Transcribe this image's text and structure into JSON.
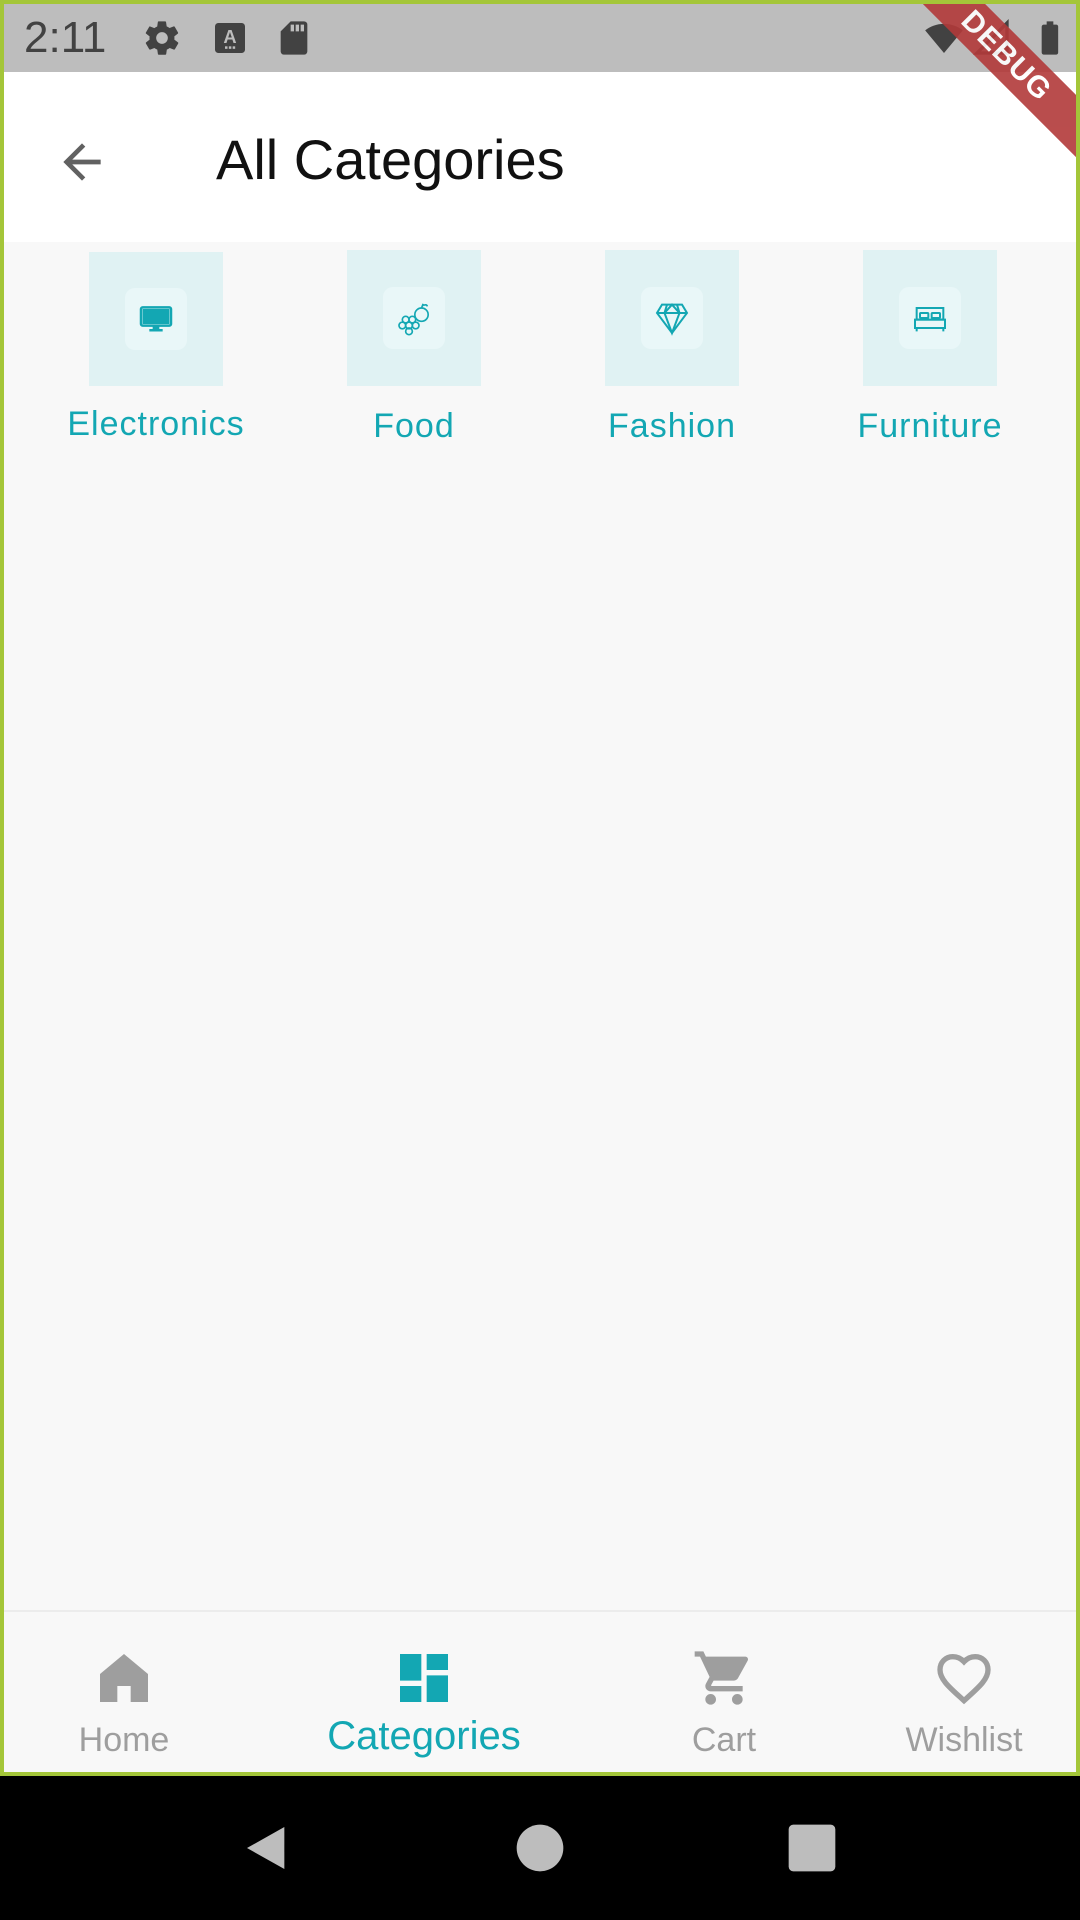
{
  "status_bar": {
    "time": "2:11",
    "icons": [
      "gear-icon",
      "keyboard-icon",
      "sd-card-icon",
      "wifi-icon",
      "signal-icon",
      "battery-icon"
    ],
    "debug_label": "DEBUG"
  },
  "app_bar": {
    "title": "All Categories",
    "back_icon": "arrow-back-icon"
  },
  "colors": {
    "accent": "#13a7b3",
    "tile_background": "#e0f2f3",
    "inactive": "#9e9e9e",
    "frame_border": "#a4c639"
  },
  "categories": [
    {
      "label": "Electronics",
      "icon": "monitor-icon"
    },
    {
      "label": "Food",
      "icon": "fruit-icon"
    },
    {
      "label": "Fashion",
      "icon": "diamond-icon"
    },
    {
      "label": "Furniture",
      "icon": "bed-icon"
    }
  ],
  "bottom_nav": {
    "items": [
      {
        "label": "Home",
        "icon": "home-icon",
        "active": false
      },
      {
        "label": "Categories",
        "icon": "dashboard-icon",
        "active": true
      },
      {
        "label": "Cart",
        "icon": "cart-icon",
        "active": false
      },
      {
        "label": "Wishlist",
        "icon": "heart-icon",
        "active": false
      }
    ]
  },
  "system_nav": {
    "icons": [
      "back-triangle-icon",
      "home-circle-icon",
      "recents-square-icon"
    ]
  }
}
